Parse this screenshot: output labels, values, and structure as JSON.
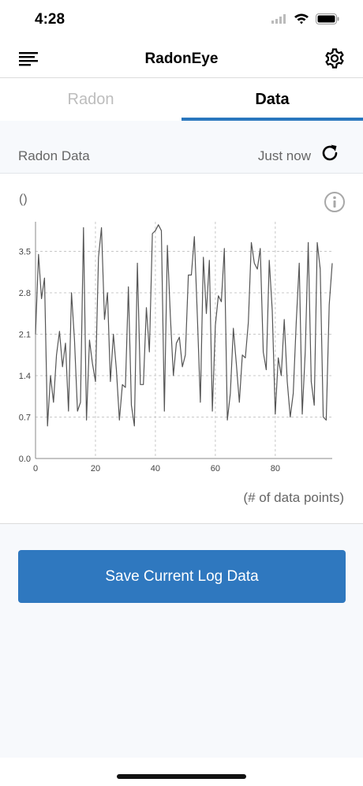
{
  "status_bar": {
    "time": "4:28"
  },
  "nav": {
    "title": "RadonEye"
  },
  "tabs": [
    {
      "label": "Radon",
      "active": false
    },
    {
      "label": "Data",
      "active": true
    }
  ],
  "section": {
    "title": "Radon Data",
    "updated": "Just now"
  },
  "chart": {
    "unit_label": "()",
    "x_caption": "(# of data points)"
  },
  "chart_data": {
    "type": "line",
    "xlim": [
      0,
      99
    ],
    "ylim": [
      0,
      4.0
    ],
    "xticks": [
      0,
      20,
      40,
      60,
      80
    ],
    "yticks": [
      0.0,
      0.7,
      1.4,
      2.1,
      2.8,
      3.5
    ],
    "ytick_labels": [
      "0.0",
      "0.7",
      "1.4",
      "2.1",
      "2.8",
      "3.5"
    ],
    "xlabel": "(# of data points)",
    "ylabel": "()",
    "grid": true,
    "line_color": "#555555",
    "values": [
      2.1,
      3.45,
      2.7,
      3.05,
      0.55,
      1.4,
      0.95,
      1.75,
      2.15,
      1.55,
      1.95,
      0.8,
      2.8,
      2.0,
      0.8,
      0.95,
      3.9,
      0.65,
      2.0,
      1.6,
      1.3,
      3.4,
      3.9,
      2.35,
      2.8,
      1.3,
      2.1,
      1.5,
      0.65,
      1.25,
      1.2,
      2.9,
      0.9,
      0.55,
      3.3,
      1.25,
      1.25,
      2.55,
      1.8,
      3.8,
      3.85,
      3.95,
      3.85,
      0.8,
      3.6,
      2.4,
      1.4,
      1.95,
      2.05,
      1.55,
      1.75,
      3.1,
      3.1,
      3.75,
      2.4,
      0.95,
      3.4,
      2.45,
      3.35,
      0.8,
      2.25,
      2.75,
      2.65,
      3.55,
      0.65,
      1.1,
      2.2,
      1.6,
      0.95,
      1.75,
      1.7,
      2.3,
      3.65,
      3.3,
      3.2,
      3.55,
      1.8,
      1.5,
      3.35,
      2.5,
      0.75,
      1.7,
      1.4,
      2.35,
      1.3,
      0.7,
      1.1,
      2.3,
      3.3,
      0.75,
      1.8,
      3.65,
      1.3,
      0.9,
      3.65,
      3.2,
      0.7,
      0.65,
      2.6,
      3.3
    ]
  },
  "actions": {
    "save_label": "Save Current Log Data"
  },
  "colors": {
    "accent": "#2a77be",
    "button": "#2f78bf"
  }
}
